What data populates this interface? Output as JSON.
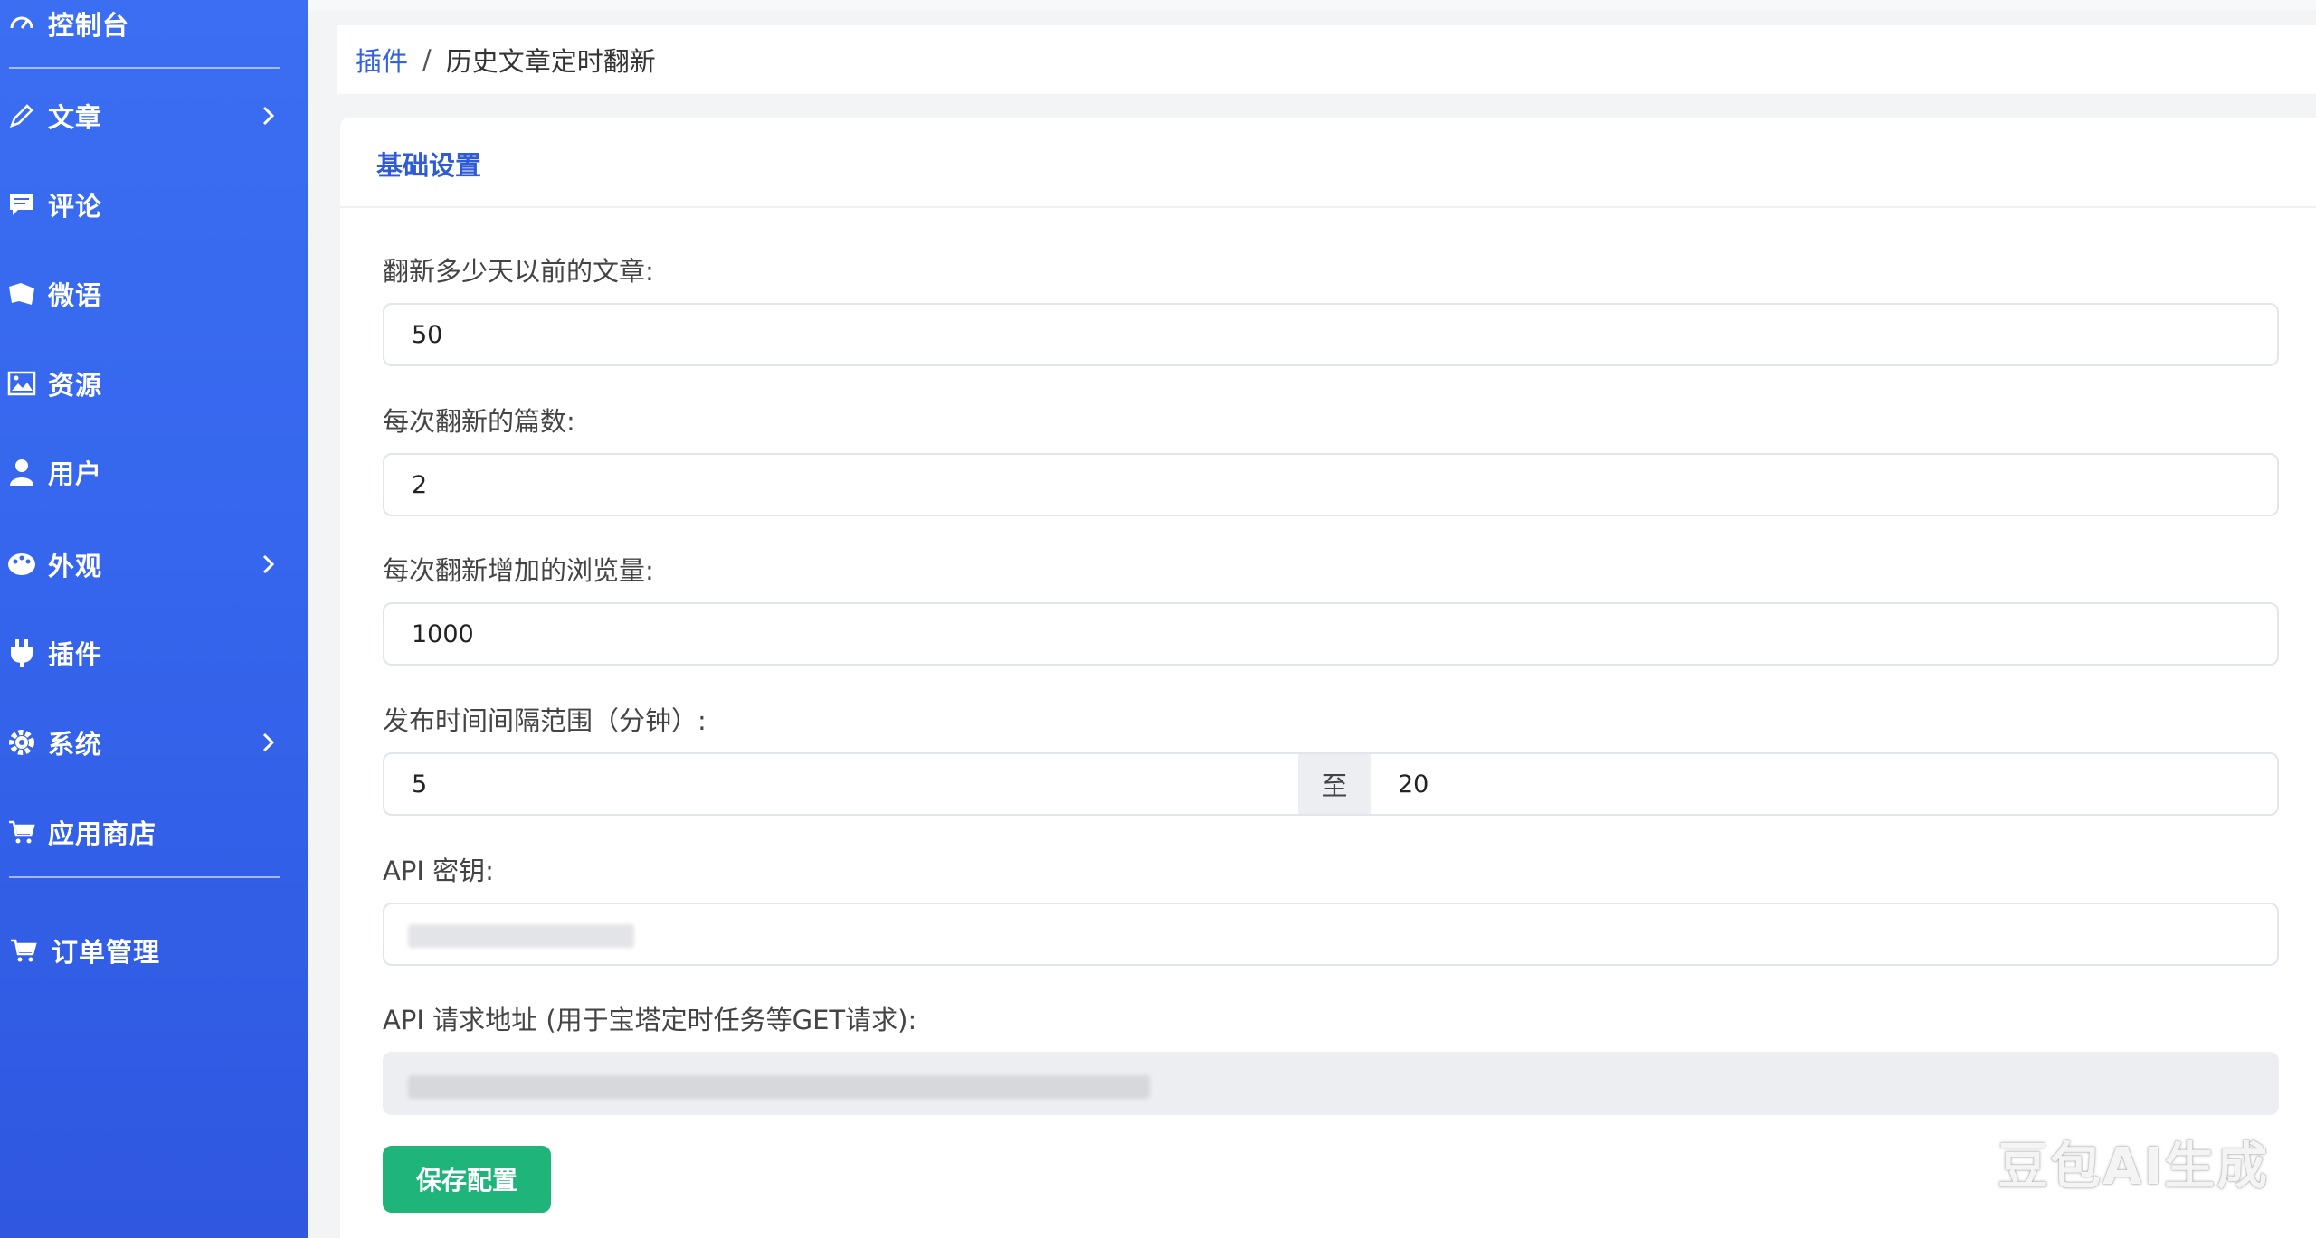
{
  "sidebar": {
    "items": [
      {
        "label": "控制台",
        "icon": "dashboard-icon"
      },
      {
        "label": "文章",
        "icon": "pencil-icon",
        "has_submenu": true
      },
      {
        "label": "评论",
        "icon": "comment-icon"
      },
      {
        "label": "微语",
        "icon": "microblog-icon"
      },
      {
        "label": "资源",
        "icon": "image-icon"
      },
      {
        "label": "用户",
        "icon": "user-icon"
      },
      {
        "label": "外观",
        "icon": "palette-icon",
        "has_submenu": true
      },
      {
        "label": "插件",
        "icon": "plug-icon"
      },
      {
        "label": "系统",
        "icon": "gear-icon",
        "has_submenu": true
      },
      {
        "label": "应用商店",
        "icon": "cart-icon"
      },
      {
        "label": "订单管理",
        "icon": "cart-icon"
      }
    ]
  },
  "breadcrumb": {
    "parent": "插件",
    "separator": "/",
    "current": "历史文章定时翻新"
  },
  "card": {
    "title": "基础设置"
  },
  "form": {
    "days": {
      "label": "翻新多少天以前的文章:",
      "value": "50"
    },
    "count": {
      "label": "每次翻新的篇数:",
      "value": "2"
    },
    "views": {
      "label": "每次翻新增加的浏览量:",
      "value": "1000"
    },
    "interval": {
      "label": "发布时间间隔范围（分钟）:",
      "min": "5",
      "sep": "至",
      "max": "20"
    },
    "api_key": {
      "label": "API 密钥:",
      "value": ""
    },
    "api_url": {
      "label": "API 请求地址 (用于宝塔定时任务等GET请求):",
      "value": ""
    }
  },
  "buttons": {
    "save": "保存配置"
  },
  "watermark": "豆包AI生成",
  "colors": {
    "sidebar": "#3667ee",
    "accent": "#2f5bd6",
    "save_button": "#1fb57a"
  }
}
